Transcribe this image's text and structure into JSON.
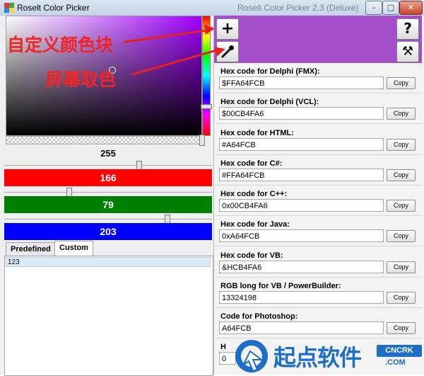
{
  "window": {
    "title": "Roselt Color Picker",
    "background_title": "Roselt Color Picker 2.3 (Deluxe)",
    "controls": {
      "minimize": "–",
      "maximize": "□",
      "close": "✕"
    }
  },
  "picker": {
    "current_hex": "#A64FCB",
    "alpha": "255",
    "red": "166",
    "green": "79",
    "blue": "203",
    "colors": {
      "red_bar": "#ff0000",
      "green_bar": "#008000",
      "blue_bar": "#0000ff"
    }
  },
  "tabs": [
    {
      "label": "Predefined",
      "active": false
    },
    {
      "label": "Custom",
      "active": true
    }
  ],
  "custom_list": [
    "123"
  ],
  "tool_buttons": {
    "add_custom": {
      "icon": "plus-icon",
      "glyph": "+"
    },
    "eyedropper": {
      "icon": "eyedropper-icon"
    },
    "help": {
      "icon": "help-icon",
      "glyph": "?"
    },
    "settings": {
      "icon": "tools-icon",
      "glyph": "⚒"
    }
  },
  "codes": [
    {
      "label": "Hex code for Delphi (FMX):",
      "value": "$FFA64FCB",
      "button": "Copy"
    },
    {
      "label": "Hex code for Delphi (VCL):",
      "value": "$00CB4FA6",
      "button": "Copy"
    },
    {
      "label": "Hex code for HTML:",
      "value": "#A64FCB",
      "button": "Copy"
    },
    {
      "label": "Hex code for C#:",
      "value": "#FFA64FCB",
      "button": "Copy"
    },
    {
      "label": "Hex code for C++:",
      "value": "0x00CB4FA6",
      "button": "Copy"
    },
    {
      "label": "Hex code for Java:",
      "value": "0xA64FCB",
      "button": "Copy"
    },
    {
      "label": "Hex code for VB:",
      "value": "&HCB4FA6",
      "button": "Copy"
    },
    {
      "label": "RGB long for VB / PowerBuilder:",
      "value": "13324198",
      "button": "Copy"
    },
    {
      "label": "Code for Photoshop:",
      "value": "A64FCB",
      "button": "Copy"
    },
    {
      "label": "H",
      "value": "0",
      "button": ""
    }
  ],
  "annotations": {
    "custom_block": "自定义颜色块",
    "screen_pick": "屏幕取色"
  },
  "watermark": {
    "brand": "起点软件",
    "badge": "CNCRK",
    "domain": ".COM"
  }
}
